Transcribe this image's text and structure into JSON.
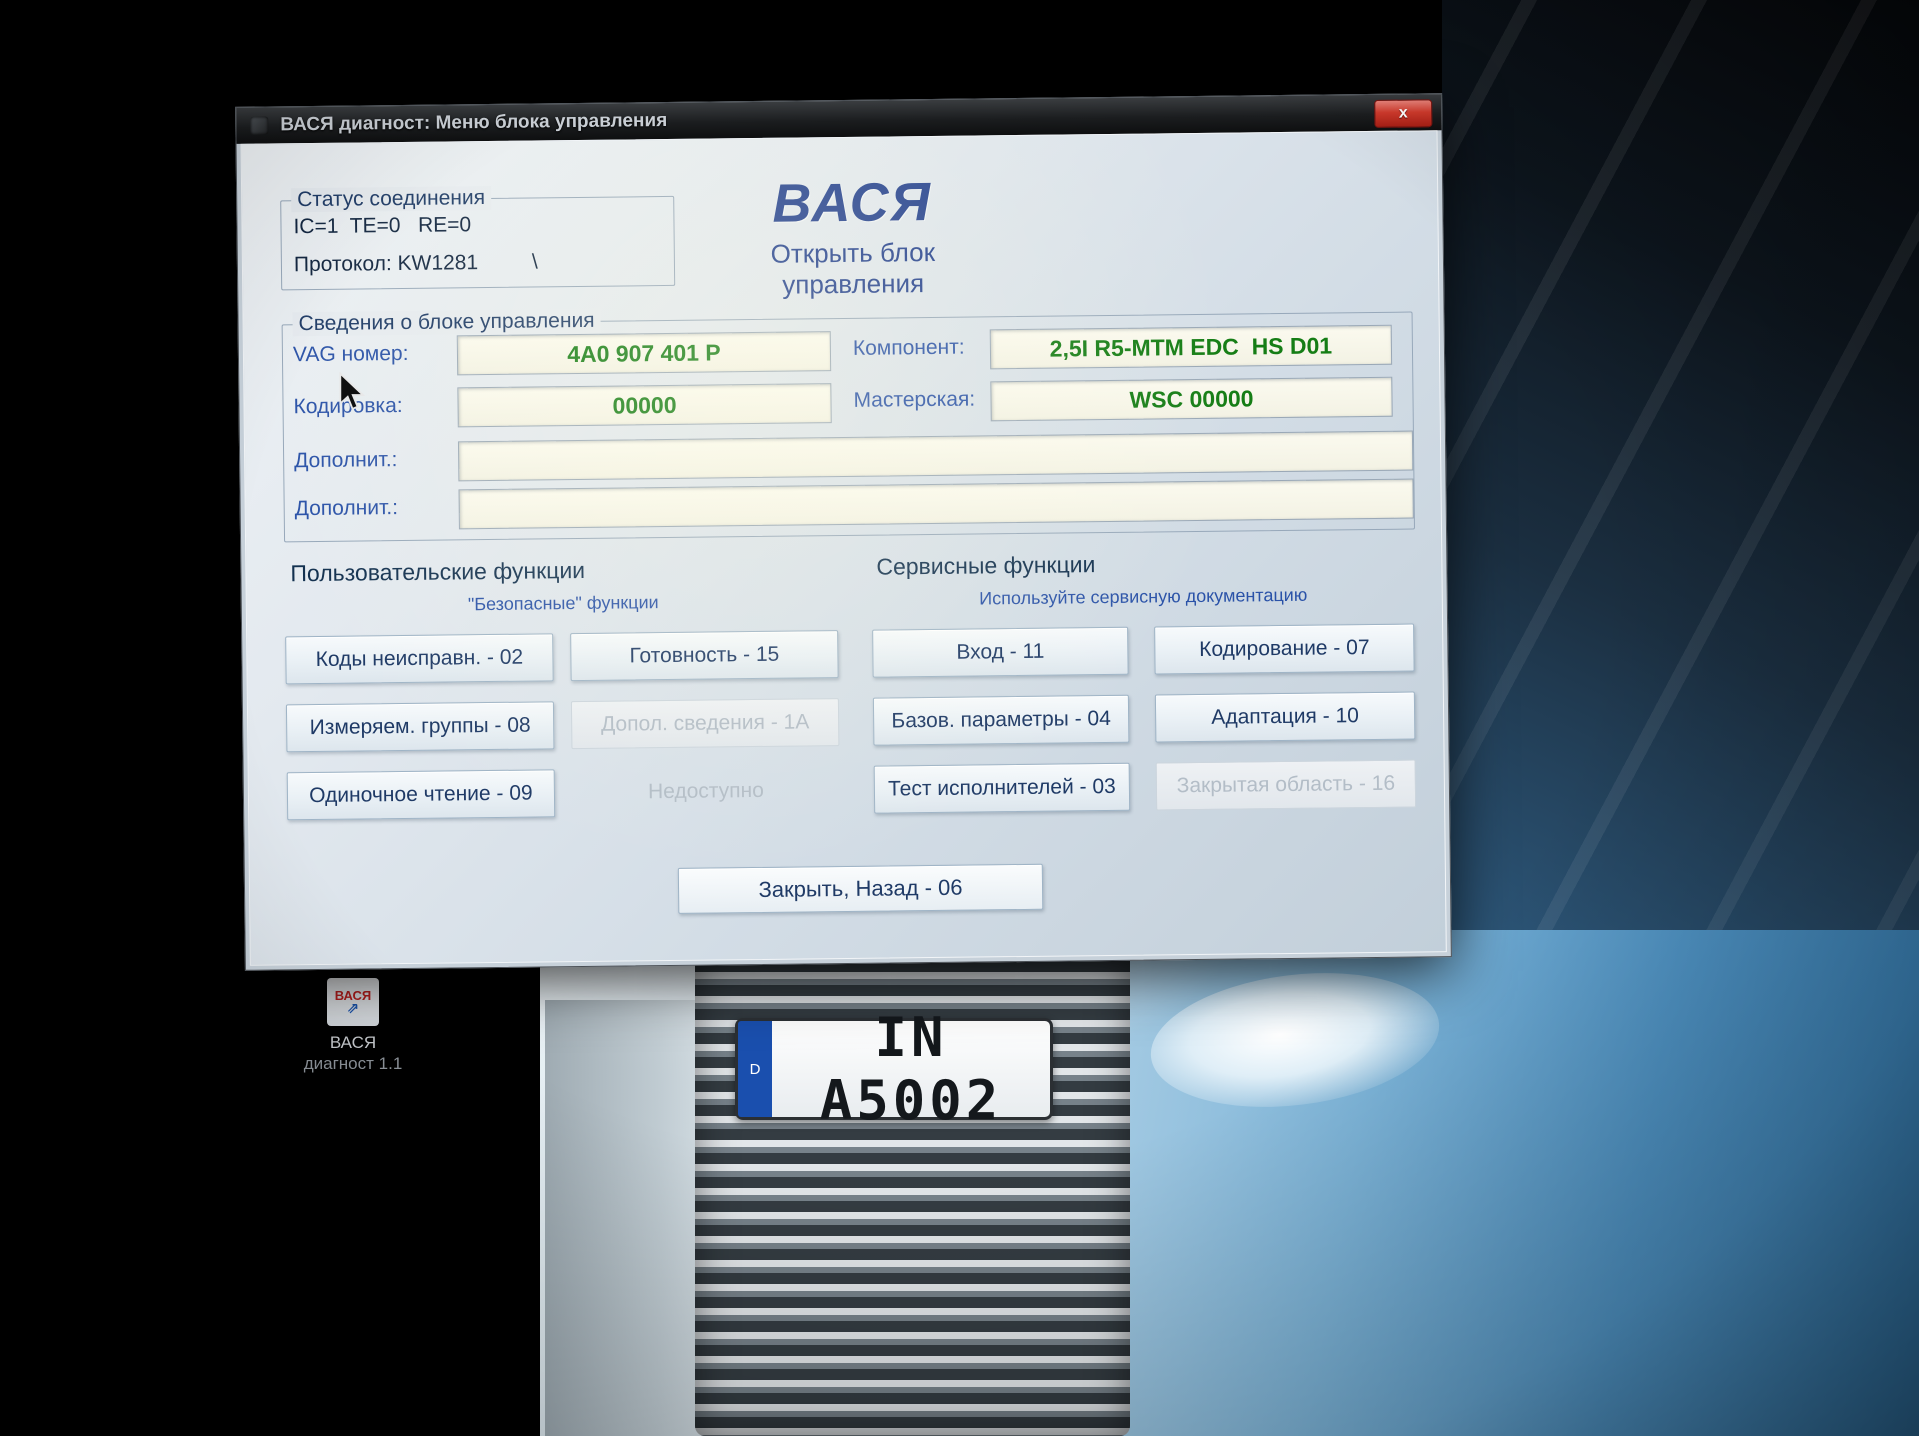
{
  "colors": {
    "value_green": "#157d15",
    "label_blue": "#2a52a8",
    "disabled_gray": "#b3bdc7",
    "close_red": "#cf3a2c"
  },
  "desktop": {
    "icon_label_line1": "ВАСЯ",
    "icon_label_line2": "диагност 1.1",
    "icon_glyph_red": "ВАСЯ",
    "icon_glyph_blue": "⇗",
    "plate_text": "IN A5002",
    "plate_band": "D"
  },
  "window": {
    "title": "ВАСЯ диагност: Меню блока управления",
    "close_label": "x"
  },
  "status": {
    "group_title": "Статус соединения",
    "line1": "IC=1  TE=0   RE=0",
    "protocol_line": "Протокол: KW1281",
    "slash": "\\"
  },
  "logo": {
    "title": "ВАСЯ",
    "subtitle": "Открыть блок управления"
  },
  "info": {
    "group_title": "Сведения о блоке управления",
    "vag_label": "VAG номер:",
    "vag_value": "4A0 907 401 P",
    "component_label": "Компонент:",
    "component_value": "2,5I R5-MTM EDC  HS D01",
    "coding_label": "Кодировка:",
    "coding_value": "00000",
    "wsc_label": "Мастерская:",
    "wsc_value": "WSC 00000",
    "extra1_label": "Дополнит.:",
    "extra1_value": "",
    "extra2_label": "Дополнит.:",
    "extra2_value": ""
  },
  "user_functions": {
    "title": "Пользовательские функции",
    "subtitle": "\"Безопасные\" функции",
    "buttons": [
      {
        "label": "Коды неисправн. - 02",
        "enabled": true
      },
      {
        "label": "Готовность - 15",
        "enabled": true
      },
      {
        "label": "Измеряем. группы - 08",
        "enabled": true
      },
      {
        "label": "Допол. сведения - 1A",
        "enabled": false
      },
      {
        "label": "Одиночное чтение - 09",
        "enabled": true
      },
      {
        "label": "Недоступно",
        "enabled": false
      }
    ]
  },
  "service_functions": {
    "title": "Сервисные функции",
    "subtitle": "Используйте сервисную документацию",
    "buttons": [
      {
        "label": "Вход - 11",
        "enabled": true
      },
      {
        "label": "Кодирование - 07",
        "enabled": true
      },
      {
        "label": "Базов. параметры - 04",
        "enabled": true
      },
      {
        "label": "Адаптация - 10",
        "enabled": true
      },
      {
        "label": "Тест исполнителей - 03",
        "enabled": true
      },
      {
        "label": "Закрытая область - 16",
        "enabled": false
      }
    ]
  },
  "footer": {
    "close_back_label": "Закрыть, Назад - 06"
  }
}
